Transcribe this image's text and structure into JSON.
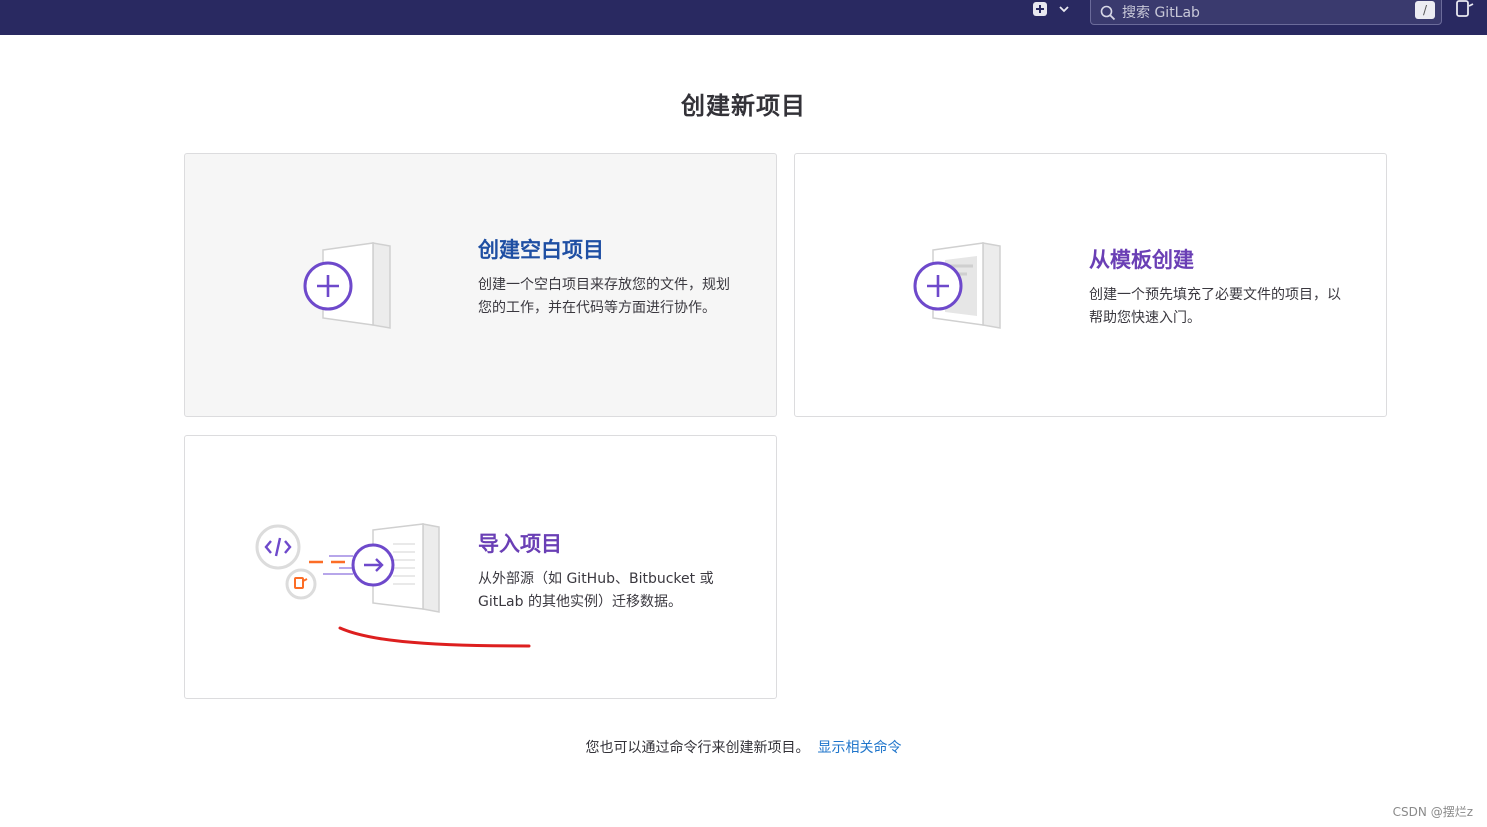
{
  "search": {
    "placeholder": "搜索 GitLab",
    "shortcut": "/"
  },
  "page": {
    "title": "创建新项目"
  },
  "cards": [
    {
      "title": "创建空白项目",
      "description": "创建一个空白项目来存放您的文件，规划您的工作，并在代码等方面进行协作。"
    },
    {
      "title": "从模板创建",
      "description": "创建一个预先填充了必要文件的项目，以帮助您快速入门。"
    },
    {
      "title": "导入项目",
      "description": "从外部源（如 GitHub、Bitbucket 或 GitLab 的其他实例）迁移数据。"
    }
  ],
  "cli": {
    "text": "您也可以通过命令行来创建新项目。",
    "link": "显示相关命令"
  },
  "watermark": "CSDN @摆烂z",
  "colors": {
    "navbar": "#292961",
    "accent_purple": "#6a3fb5",
    "link_blue": "#1f75cb",
    "annotation_red": "#dd1f1f"
  }
}
